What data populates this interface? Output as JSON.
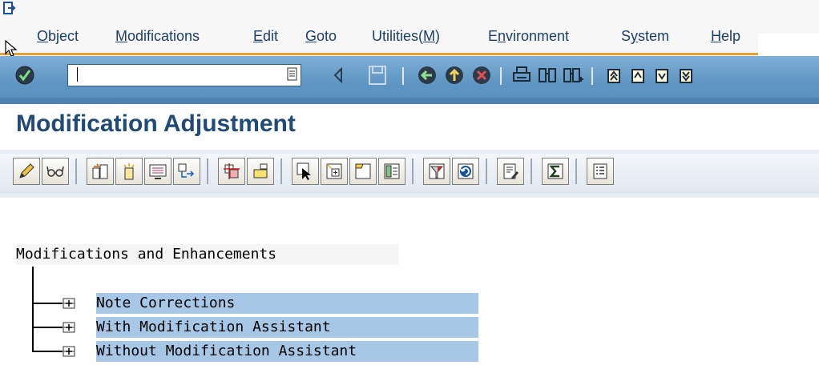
{
  "menubar": {
    "items": [
      {
        "pre": "",
        "ul": "O",
        "post": "bject"
      },
      {
        "pre": "",
        "ul": "M",
        "post": "odifications"
      },
      {
        "pre": "",
        "ul": "E",
        "post": "dit"
      },
      {
        "pre": "",
        "ul": "G",
        "post": "oto"
      },
      {
        "pre": "Utilities(",
        "ul": "M",
        "post": ")"
      },
      {
        "pre": "E",
        "ul": "n",
        "post": "vironment"
      },
      {
        "pre": "S",
        "ul": "y",
        "post": "stem"
      },
      {
        "pre": "",
        "ul": "H",
        "post": "elp"
      }
    ]
  },
  "toolbar": {
    "command_field_value": "",
    "icons": [
      "enter-icon",
      "command-field-dropdown-icon",
      "back-arrow-icon",
      "save-icon",
      "back-icon",
      "exit-icon",
      "cancel-icon",
      "print-icon",
      "find-icon",
      "find-next-icon",
      "first-page-icon",
      "previous-page-icon",
      "next-page-icon",
      "last-page-icon"
    ]
  },
  "page": {
    "title": "Modification Adjustment"
  },
  "app_toolbar": {
    "icons": [
      "edit-icon",
      "display-icon",
      "adjust-icon",
      "reset-icon",
      "info-icon",
      "transfer-icon",
      "hierarchy-icon",
      "select-icon",
      "choose-icon",
      "expand-icon",
      "collapse-icon",
      "subtree-icon",
      "filter-icon",
      "refresh-icon",
      "document-icon",
      "sum-icon",
      "legend-icon"
    ]
  },
  "tree": {
    "root_label": "Modifications and Enhancements",
    "nodes": [
      {
        "label": "Note Corrections"
      },
      {
        "label": "With Modification Assistant"
      },
      {
        "label": "Without Modification Assistant"
      }
    ]
  },
  "colors": {
    "menu_text": "#1c3f6e",
    "toolbar_blue": "#5e95c2",
    "title_blue": "#204a78",
    "node_highlight": "#a7c7e7",
    "accent_orange": "#e8a030"
  }
}
